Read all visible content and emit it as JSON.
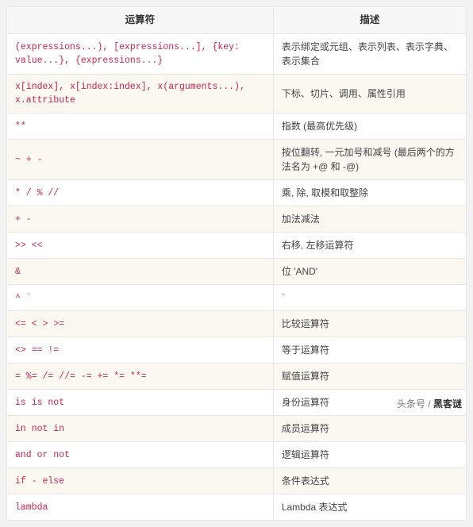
{
  "table": {
    "headers": {
      "op": "运算符",
      "desc": "描述"
    },
    "rows": [
      {
        "op": "(expressions...), [expressions...], {key: value...}, {expressions...}",
        "desc": "表示绑定或元组、表示列表、表示字典、表示集合",
        "shade": false
      },
      {
        "op": "x[index], x[index:index], x(arguments...), x.attribute",
        "desc": "下标、切片、调用、属性引用",
        "shade": true
      },
      {
        "op": "**",
        "desc": "指数 (最高优先级)",
        "shade": false
      },
      {
        "op": "~ + -",
        "desc": "按位翻转, 一元加号和减号 (最后两个的方法名为 +@ 和 -@)",
        "shade": true
      },
      {
        "op": "* / % //",
        "desc": "乘, 除, 取模和取整除",
        "shade": false
      },
      {
        "op": "+ -",
        "desc": "加法减法",
        "shade": true
      },
      {
        "op": ">> <<",
        "desc": "右移, 左移运算符",
        "shade": false
      },
      {
        "op": "&",
        "desc": "位 'AND'",
        "shade": true
      },
      {
        "op": "^ `",
        "desc": "`",
        "shade": false
      },
      {
        "op": "<= < > >=",
        "desc": "比较运算符",
        "shade": true
      },
      {
        "op": "<> == !=",
        "desc": "等于运算符",
        "shade": false
      },
      {
        "op": "= %= /= //= -= += *= **=",
        "desc": "赋值运算符",
        "shade": true
      },
      {
        "op": "is is not",
        "desc": "身份运算符",
        "shade": false
      },
      {
        "op": "in not in",
        "desc": "成员运算符",
        "shade": true
      },
      {
        "op": "and or not",
        "desc": "逻辑运算符",
        "shade": false
      },
      {
        "op": "if - else",
        "desc": "条件表达式",
        "shade": true
      },
      {
        "op": "lambda",
        "desc": "Lambda 表达式",
        "shade": false
      }
    ]
  },
  "watermark": {
    "left": "头条号 / ",
    "right": "黑客谜"
  }
}
